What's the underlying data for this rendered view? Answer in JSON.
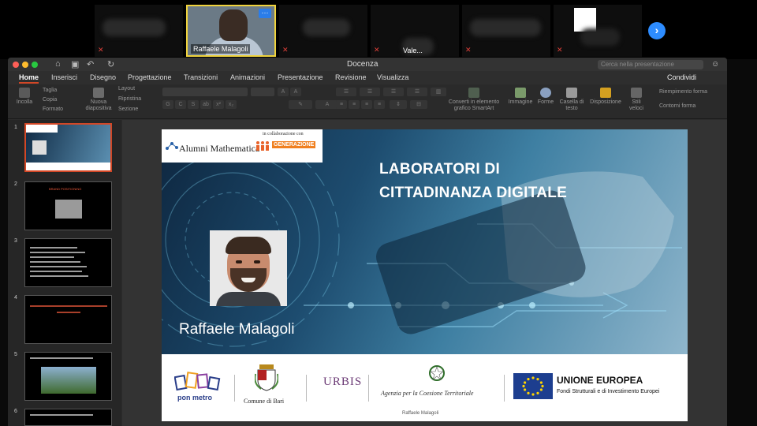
{
  "meeting": {
    "participants": [
      {
        "name": "",
        "muted": true
      },
      {
        "name": "Raffaele Malagoli",
        "muted": false,
        "active": true
      },
      {
        "name": "",
        "muted": true
      },
      {
        "name": "Vale...",
        "muted": true
      },
      {
        "name": "",
        "muted": true
      },
      {
        "name": "",
        "muted": true
      }
    ],
    "more_label": "···",
    "next_label": "›"
  },
  "app": {
    "title": "Docenza",
    "search_placeholder": "Cerca nella presentazione",
    "share_label": "Condividi",
    "tabs": [
      "Home",
      "Inserisci",
      "Disegno",
      "Progettazione",
      "Transizioni",
      "Animazioni",
      "Presentazione",
      "Revisione",
      "Visualizza"
    ],
    "selected_tab": "Home"
  },
  "ribbon": {
    "paste": "Incolla",
    "cut": "Taglia",
    "copy": "Copia",
    "format": "Formato",
    "new_slide": "Nuova diapositiva",
    "layout": "Layout",
    "reset": "Ripristina",
    "section": "Sezione",
    "smartart": "Converti in elemento grafico SmartArt",
    "image": "Immagine",
    "shapes": "Forme",
    "textbox": "Casella di testo",
    "arrange": "Disposizione",
    "quick_styles": "Stili veloci",
    "fill": "Riempimento forma",
    "outline": "Contorni forma"
  },
  "thumbnails": [
    {
      "num": "1",
      "selected": true
    },
    {
      "num": "2",
      "text": "BRAND POSITIONING"
    },
    {
      "num": "3"
    },
    {
      "num": "4"
    },
    {
      "num": "5"
    },
    {
      "num": "6"
    }
  ],
  "slide": {
    "collab_label": "in collaborazione con",
    "logo_alumni": "Alumni Mathematica",
    "logo_generazione": "GENERAZIONE",
    "title_line1": "LABORATORI DI",
    "title_line2": "CITTADINANZA DIGITALE",
    "presenter": "Raffaele Malagoli",
    "footer": {
      "ponmetro": "pon metro",
      "bari": "Comune di Bari",
      "urbis": "URBIS",
      "agency": "Agenzia per la Coesione Territoriale",
      "credit": "Raffaele Malagoli",
      "eu_title": "UNIONE EUROPEA",
      "eu_sub": "Fondi Strutturali e di Investimento Europei"
    }
  },
  "colors": {
    "accent": "#d24726",
    "zoom_blue": "#2d8cff",
    "eu_blue": "#1d3e8f"
  }
}
